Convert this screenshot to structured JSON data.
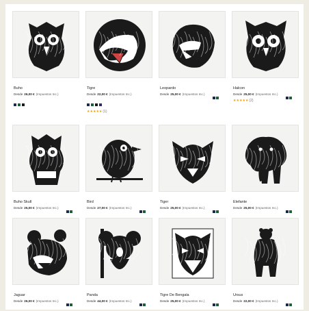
{
  "products": [
    {
      "name": "Buho",
      "old": "Desde",
      "price": "26,00 €",
      "tax": "(Impuestos Inc.)",
      "swatches": [
        "#1b2a4a",
        "#1e5d3a",
        "#1a1a1a"
      ],
      "swatch_layout": "below",
      "rating": "",
      "rating_count": "",
      "art": "owl"
    },
    {
      "name": "Tigre",
      "old": "Desde",
      "price": "22,00 €",
      "tax": "(Impuestos Inc.)",
      "swatches": [
        "#1b2a4a",
        "#1e5d3a",
        "#1a1a1a",
        "#2b2b6a"
      ],
      "swatch_layout": "below",
      "rating": "★★★★★",
      "rating_count": "(1)",
      "art": "tiger-round"
    },
    {
      "name": "Leopardo",
      "old": "Desde",
      "price": "25,00 €",
      "tax": "(Impuestos Inc.)",
      "swatches": [
        "#1b2a4a",
        "#1e5d3a"
      ],
      "swatch_layout": "inline",
      "rating": "",
      "rating_count": "",
      "art": "leopard"
    },
    {
      "name": "Halcon",
      "old": "Desde",
      "price": "25,00 €",
      "tax": "(Impuestos Inc.)",
      "swatches": [
        "#1b2a4a",
        "#1e5d3a"
      ],
      "swatch_layout": "inline",
      "rating": "★★★★★",
      "rating_count": "(2)",
      "art": "owl2"
    },
    {
      "name": "Buho Skull",
      "old": "Desde",
      "price": "25,00 €",
      "tax": "(Impuestos Inc.)",
      "swatches": [
        "#1b2a4a",
        "#1e5d3a"
      ],
      "swatch_layout": "inline",
      "rating": "",
      "rating_count": "",
      "art": "owl-skull"
    },
    {
      "name": "Bird",
      "old": "Desde",
      "price": "27,00 €",
      "tax": "(Impuestos Inc.)",
      "swatches": [
        "#1b2a4a",
        "#1e5d3a"
      ],
      "swatch_layout": "inline",
      "rating": "",
      "rating_count": "",
      "art": "bird"
    },
    {
      "name": "Tiger",
      "old": "Desde",
      "price": "25,00 €",
      "tax": "(Impuestos Inc.)",
      "swatches": [
        "#1b2a4a",
        "#1e5d3a"
      ],
      "swatch_layout": "inline",
      "rating": "",
      "rating_count": "",
      "art": "tiger"
    },
    {
      "name": "Elefante",
      "old": "Desde",
      "price": "25,00 €",
      "tax": "(Impuestos Inc.)",
      "swatches": [
        "#1b2a4a",
        "#1e5d3a"
      ],
      "swatch_layout": "inline",
      "rating": "",
      "rating_count": "",
      "art": "elephant"
    },
    {
      "name": "Jaguar",
      "old": "Desde",
      "price": "26,00 €",
      "tax": "(Impuestos Inc.)",
      "swatches": [
        "#1b2a4a",
        "#1e5d3a"
      ],
      "swatch_layout": "inline",
      "rating": "",
      "rating_count": "",
      "art": "jaguar"
    },
    {
      "name": "Panda",
      "old": "Desde",
      "price": "44,00 €",
      "tax": "(Impuestos Inc.)",
      "swatches": [
        "#1b2a4a",
        "#1e5d3a"
      ],
      "swatch_layout": "inline",
      "rating": "",
      "rating_count": "",
      "art": "koala"
    },
    {
      "name": "Tigre De Bengala",
      "old": "Desde",
      "price": "25,00 €",
      "tax": "(Impuestos Inc.)",
      "swatches": [
        "#1b2a4a",
        "#1e5d3a"
      ],
      "swatch_layout": "inline",
      "rating": "",
      "rating_count": "",
      "art": "tiger-face"
    },
    {
      "name": "Ursus",
      "old": "Desde",
      "price": "22,00 €",
      "tax": "(Impuestos Inc.)",
      "swatches": [
        "#1b2a4a",
        "#1e5d3a"
      ],
      "swatch_layout": "inline",
      "rating": "",
      "rating_count": "",
      "art": "bear"
    }
  ]
}
